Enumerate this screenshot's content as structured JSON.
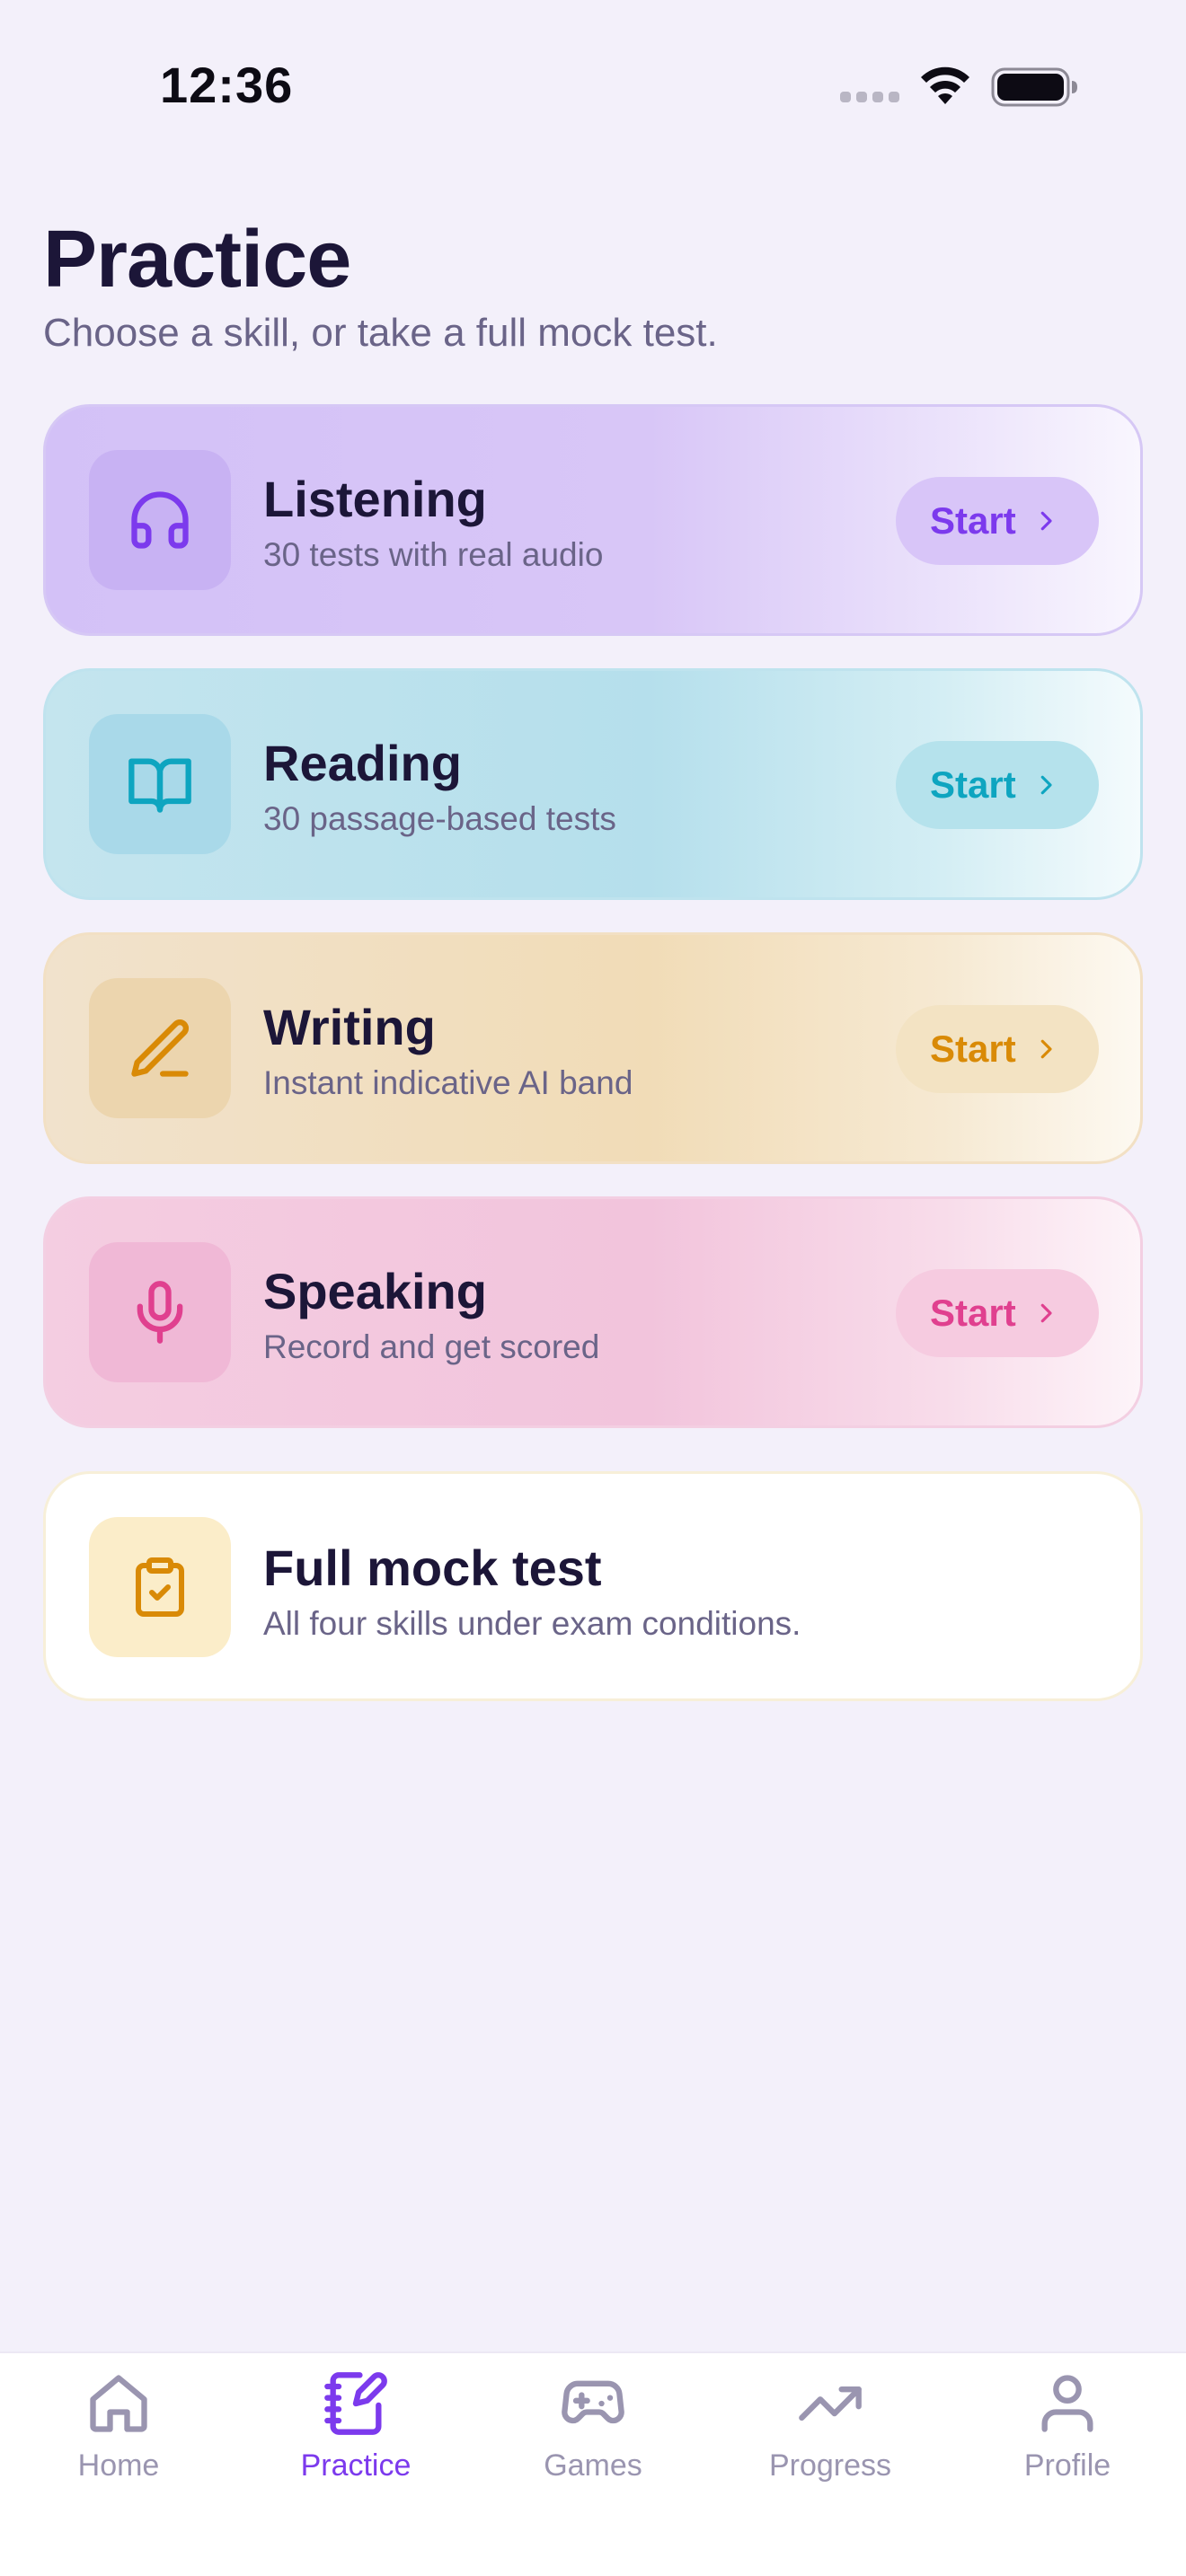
{
  "status_bar": {
    "time": "12:36"
  },
  "header": {
    "title": "Practice",
    "subtitle": "Choose a skill, or take a full mock test."
  },
  "skills": [
    {
      "title": "Listening",
      "subtitle": "30 tests with real audio",
      "button": "Start",
      "icon": "headphones-icon",
      "accent": "#7c3aed"
    },
    {
      "title": "Reading",
      "subtitle": "30 passage-based tests",
      "button": "Start",
      "icon": "book-open-icon",
      "accent": "#0ea5c0"
    },
    {
      "title": "Writing",
      "subtitle": "Instant indicative AI band",
      "button": "Start",
      "icon": "pen-line-icon",
      "accent": "#d98a06"
    },
    {
      "title": "Speaking",
      "subtitle": "Record and get scored",
      "button": "Start",
      "icon": "mic-icon",
      "accent": "#e0408f"
    }
  ],
  "mock_test": {
    "title": "Full mock test",
    "subtitle": "All four skills under exam conditions.",
    "icon": "clipboard-check-icon",
    "accent": "#d98a06"
  },
  "tab_bar": {
    "active": "Practice",
    "active_color": "#7c3aed",
    "tabs": [
      {
        "label": "Home",
        "icon": "home-icon"
      },
      {
        "label": "Practice",
        "icon": "notebook-pen-icon"
      },
      {
        "label": "Games",
        "icon": "gamepad-icon"
      },
      {
        "label": "Progress",
        "icon": "trending-up-icon"
      },
      {
        "label": "Profile",
        "icon": "user-icon"
      }
    ]
  }
}
